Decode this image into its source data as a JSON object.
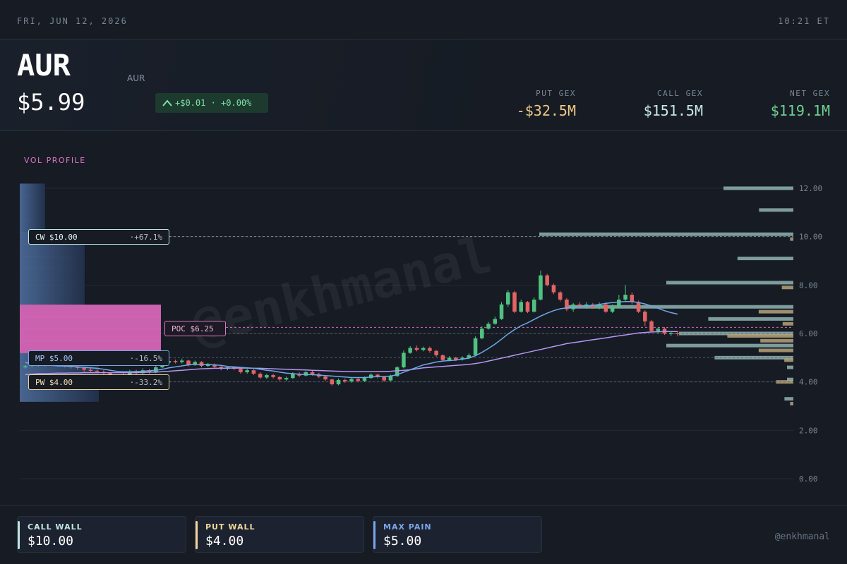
{
  "topbar": {
    "date": "FRI, JUN 12, 2026",
    "time": "10:21 ET"
  },
  "header": {
    "ticker": "AUR",
    "subname": "AUR",
    "price": "$5.99",
    "change": "+$0.01 · +0.00%",
    "put_gex": {
      "label": "PUT GEX",
      "value": "-$32.5M"
    },
    "call_gex": {
      "label": "CALL GEX",
      "value": "$151.5M"
    },
    "net_gex": {
      "label": "NET GEX",
      "value": "$119.1M"
    }
  },
  "chart": {
    "vol_profile_label": "VOL PROFILE",
    "watermark": "@enkhmanal",
    "tags": {
      "cw": {
        "label": "CW $10.00",
        "pct": "·+67.1%"
      },
      "mp": {
        "label": "MP $5.00",
        "pct": "·-16.5%"
      },
      "pw": {
        "label": "PW $4.00",
        "pct": "·-33.2%"
      },
      "poc": {
        "label": "POC $6.25"
      }
    }
  },
  "chart_data": {
    "type": "candlestick",
    "y_ticks": [
      "12.00",
      "10.00",
      "8.00",
      "6.00",
      "4.00",
      "2.00",
      "0.00"
    ],
    "ylim": [
      0,
      12
    ],
    "levels": {
      "call_wall": 10.0,
      "max_pain": 5.0,
      "put_wall": 4.0,
      "poc": 6.25,
      "last": 5.99
    },
    "candles": [
      [
        4.6,
        4.65,
        4.55,
        4.7
      ],
      [
        4.66,
        4.72,
        4.6,
        4.78
      ],
      [
        4.72,
        4.68,
        4.62,
        4.8
      ],
      [
        4.68,
        4.74,
        4.64,
        4.8
      ],
      [
        4.74,
        4.7,
        4.66,
        4.82
      ],
      [
        4.7,
        4.72,
        4.64,
        4.78
      ],
      [
        4.72,
        4.66,
        4.6,
        4.78
      ],
      [
        4.66,
        4.62,
        4.55,
        4.7
      ],
      [
        4.62,
        4.58,
        4.5,
        4.66
      ],
      [
        4.58,
        4.5,
        4.42,
        4.62
      ],
      [
        4.5,
        4.46,
        4.38,
        4.56
      ],
      [
        4.46,
        4.42,
        4.36,
        4.52
      ],
      [
        4.42,
        4.36,
        4.28,
        4.48
      ],
      [
        4.36,
        4.2,
        4.1,
        4.4
      ],
      [
        4.2,
        3.92,
        3.84,
        4.24
      ],
      [
        3.92,
        4.3,
        3.9,
        4.36
      ],
      [
        4.3,
        4.42,
        4.24,
        4.5
      ],
      [
        4.42,
        4.36,
        4.3,
        4.5
      ],
      [
        4.36,
        4.48,
        4.3,
        4.56
      ],
      [
        4.48,
        4.4,
        4.34,
        4.54
      ],
      [
        4.4,
        4.6,
        4.36,
        4.66
      ],
      [
        4.6,
        4.8,
        4.56,
        4.9
      ],
      [
        4.8,
        4.86,
        4.74,
        4.94
      ],
      [
        4.86,
        4.82,
        4.76,
        4.92
      ],
      [
        4.82,
        4.88,
        4.76,
        4.96
      ],
      [
        4.88,
        4.7,
        4.64,
        4.92
      ],
      [
        4.7,
        4.82,
        4.66,
        4.88
      ],
      [
        4.82,
        4.66,
        4.6,
        4.86
      ],
      [
        4.66,
        4.72,
        4.6,
        4.78
      ],
      [
        4.72,
        4.62,
        4.56,
        4.76
      ],
      [
        4.62,
        4.54,
        4.48,
        4.66
      ],
      [
        4.54,
        4.6,
        4.48,
        4.66
      ],
      [
        4.6,
        4.54,
        4.48,
        4.64
      ],
      [
        4.54,
        4.4,
        4.34,
        4.58
      ],
      [
        4.4,
        4.48,
        4.34,
        4.54
      ],
      [
        4.48,
        4.34,
        4.28,
        4.52
      ],
      [
        4.34,
        4.18,
        4.12,
        4.4
      ],
      [
        4.18,
        4.28,
        4.12,
        4.34
      ],
      [
        4.28,
        4.2,
        4.14,
        4.34
      ],
      [
        4.2,
        4.1,
        4.04,
        4.24
      ],
      [
        4.1,
        4.16,
        4.04,
        4.22
      ],
      [
        4.16,
        4.34,
        4.12,
        4.4
      ],
      [
        4.34,
        4.26,
        4.2,
        4.4
      ],
      [
        4.26,
        4.4,
        4.22,
        4.46
      ],
      [
        4.4,
        4.32,
        4.26,
        4.46
      ],
      [
        4.32,
        4.22,
        4.16,
        4.38
      ],
      [
        4.22,
        4.1,
        4.04,
        4.26
      ],
      [
        4.1,
        3.9,
        3.84,
        4.14
      ],
      [
        3.9,
        4.08,
        3.86,
        4.14
      ],
      [
        4.08,
        4.02,
        3.96,
        4.14
      ],
      [
        4.02,
        4.12,
        3.96,
        4.18
      ],
      [
        4.12,
        4.04,
        3.98,
        4.18
      ],
      [
        4.04,
        4.16,
        4.0,
        4.22
      ],
      [
        4.16,
        4.3,
        4.12,
        4.36
      ],
      [
        4.3,
        4.2,
        4.14,
        4.34
      ],
      [
        4.2,
        4.06,
        4.0,
        4.24
      ],
      [
        4.06,
        4.24,
        4.02,
        4.3
      ],
      [
        4.24,
        4.6,
        4.2,
        4.66
      ],
      [
        4.6,
        5.2,
        4.56,
        5.3
      ],
      [
        5.2,
        5.4,
        5.16,
        5.48
      ],
      [
        5.4,
        5.32,
        5.26,
        5.5
      ],
      [
        5.32,
        5.4,
        5.26,
        5.46
      ],
      [
        5.4,
        5.28,
        5.2,
        5.46
      ],
      [
        5.28,
        5.1,
        5.04,
        5.32
      ],
      [
        5.1,
        4.9,
        4.84,
        5.14
      ],
      [
        4.9,
        5.0,
        4.86,
        5.06
      ],
      [
        5.0,
        4.92,
        4.86,
        5.04
      ],
      [
        4.92,
        5.0,
        4.88,
        5.06
      ],
      [
        5.0,
        5.1,
        4.94,
        5.18
      ],
      [
        5.1,
        5.8,
        5.06,
        5.88
      ],
      [
        5.8,
        6.2,
        5.76,
        6.3
      ],
      [
        6.2,
        6.4,
        6.16,
        6.48
      ],
      [
        6.4,
        6.6,
        6.36,
        6.7
      ],
      [
        6.6,
        7.2,
        6.56,
        7.3
      ],
      [
        7.2,
        7.7,
        7.1,
        7.8
      ],
      [
        7.7,
        6.9,
        6.84,
        7.76
      ],
      [
        6.9,
        7.3,
        6.86,
        7.4
      ],
      [
        7.3,
        6.9,
        6.84,
        7.34
      ],
      [
        6.9,
        7.4,
        6.86,
        7.5
      ],
      [
        7.4,
        8.4,
        7.36,
        8.6
      ],
      [
        8.4,
        8.0,
        7.94,
        8.46
      ],
      [
        8.0,
        7.7,
        7.62,
        8.06
      ],
      [
        7.7,
        7.4,
        7.32,
        7.76
      ],
      [
        7.4,
        7.0,
        6.92,
        7.46
      ],
      [
        7.0,
        7.2,
        6.9,
        7.26
      ],
      [
        7.2,
        7.1,
        7.02,
        7.3
      ],
      [
        7.1,
        7.2,
        7.02,
        7.3
      ],
      [
        7.2,
        7.1,
        7.02,
        7.26
      ],
      [
        7.1,
        7.2,
        7.0,
        7.28
      ],
      [
        7.2,
        6.9,
        6.84,
        7.3
      ],
      [
        6.9,
        7.1,
        6.84,
        7.2
      ],
      [
        7.1,
        7.4,
        7.04,
        7.6
      ],
      [
        7.4,
        7.6,
        7.3,
        8.0
      ],
      [
        7.6,
        7.3,
        7.2,
        7.7
      ],
      [
        7.3,
        6.9,
        6.84,
        7.36
      ],
      [
        6.9,
        6.5,
        6.3,
        6.96
      ],
      [
        6.5,
        6.1,
        6.04,
        6.56
      ],
      [
        6.1,
        6.2,
        6.0,
        6.26
      ],
      [
        6.2,
        6.0,
        5.94,
        6.26
      ],
      [
        6.0,
        6.02,
        5.9,
        6.1
      ],
      [
        6.02,
        5.99,
        5.88,
        6.1
      ]
    ],
    "ma_fast": [
      4.8,
      4.76,
      4.72,
      4.7,
      4.68,
      4.66,
      4.65,
      4.64,
      4.62,
      4.6,
      4.58,
      4.56,
      4.52,
      4.48,
      4.44,
      4.42,
      4.42,
      4.43,
      4.44,
      4.46,
      4.48,
      4.52,
      4.58,
      4.62,
      4.66,
      4.7,
      4.72,
      4.72,
      4.72,
      4.7,
      4.68,
      4.64,
      4.62,
      4.6,
      4.58,
      4.56,
      4.52,
      4.48,
      4.45,
      4.4,
      4.36,
      4.34,
      4.32,
      4.3,
      4.3,
      4.28,
      4.26,
      4.24,
      4.22,
      4.2,
      4.18,
      4.18,
      4.18,
      4.2,
      4.22,
      4.22,
      4.24,
      4.3,
      4.4,
      4.5,
      4.6,
      4.7,
      4.76,
      4.82,
      4.86,
      4.88,
      4.9,
      4.94,
      4.98,
      5.08,
      5.22,
      5.38,
      5.56,
      5.76,
      5.98,
      6.16,
      6.32,
      6.44,
      6.58,
      6.72,
      6.84,
      6.94,
      7.02,
      7.06,
      7.1,
      7.12,
      7.14,
      7.16,
      7.2,
      7.24,
      7.28,
      7.3,
      7.32,
      7.32,
      7.28,
      7.22,
      7.14,
      7.04,
      6.94,
      6.86,
      6.8
    ],
    "ma_slow": [
      4.3,
      4.32,
      4.34,
      4.34,
      4.35,
      4.36,
      4.36,
      4.37,
      4.37,
      4.38,
      4.38,
      4.38,
      4.38,
      4.38,
      4.38,
      4.38,
      4.38,
      4.38,
      4.39,
      4.4,
      4.4,
      4.42,
      4.44,
      4.46,
      4.48,
      4.5,
      4.52,
      4.54,
      4.55,
      4.56,
      4.56,
      4.57,
      4.57,
      4.57,
      4.57,
      4.56,
      4.56,
      4.55,
      4.54,
      4.53,
      4.52,
      4.51,
      4.5,
      4.49,
      4.48,
      4.47,
      4.46,
      4.45,
      4.44,
      4.43,
      4.42,
      4.42,
      4.42,
      4.42,
      4.42,
      4.43,
      4.44,
      4.46,
      4.48,
      4.5,
      4.54,
      4.58,
      4.6,
      4.62,
      4.64,
      4.66,
      4.68,
      4.7,
      4.72,
      4.76,
      4.8,
      4.86,
      4.92,
      4.98,
      5.04,
      5.1,
      5.16,
      5.22,
      5.28,
      5.34,
      5.4,
      5.46,
      5.52,
      5.58,
      5.62,
      5.66,
      5.7,
      5.74,
      5.78,
      5.82,
      5.86,
      5.9,
      5.94,
      5.98,
      6.02,
      6.04,
      6.06,
      6.07,
      6.08,
      6.08,
      6.08
    ],
    "left_profile": [
      {
        "price": 12.0,
        "size": 0.18
      },
      {
        "price": 11.5,
        "size": 0.18
      },
      {
        "price": 11.0,
        "size": 0.18
      },
      {
        "price": 10.5,
        "size": 0.18
      },
      {
        "price": 10.0,
        "size": 0.46
      },
      {
        "price": 9.5,
        "size": 0.46
      },
      {
        "price": 9.0,
        "size": 0.46
      },
      {
        "price": 8.5,
        "size": 0.46
      },
      {
        "price": 8.0,
        "size": 0.46
      },
      {
        "price": 7.5,
        "size": 0.46
      },
      {
        "price": 7.0,
        "size": 1.0
      },
      {
        "price": 6.5,
        "size": 1.0
      },
      {
        "price": 6.0,
        "size": 1.0
      },
      {
        "price": 5.5,
        "size": 1.0
      },
      {
        "price": 5.0,
        "size": 0.46
      },
      {
        "price": 4.5,
        "size": 0.56
      },
      {
        "price": 4.0,
        "size": 0.56
      },
      {
        "price": 3.5,
        "size": 0.56
      }
    ],
    "right_bars_call": [
      {
        "price": 12.0,
        "size": 0.55
      },
      {
        "price": 11.1,
        "size": 0.27
      },
      {
        "price": 10.1,
        "size": 2.0
      },
      {
        "price": 9.1,
        "size": 0.44
      },
      {
        "price": 8.1,
        "size": 1.0
      },
      {
        "price": 7.1,
        "size": 1.78
      },
      {
        "price": 6.6,
        "size": 0.67
      },
      {
        "price": 6.0,
        "size": 0.9
      },
      {
        "price": 5.5,
        "size": 1.0
      },
      {
        "price": 5.0,
        "size": 0.62
      },
      {
        "price": 4.6,
        "size": 0.05
      },
      {
        "price": 4.1,
        "size": 0.05
      },
      {
        "price": 3.3,
        "size": 0.07
      }
    ],
    "right_bars_put": [
      {
        "price": 9.9,
        "size": 0.04
      },
      {
        "price": 7.9,
        "size": 0.14
      },
      {
        "price": 6.9,
        "size": 0.42
      },
      {
        "price": 6.4,
        "size": 0.13
      },
      {
        "price": 5.9,
        "size": 0.8
      },
      {
        "price": 5.7,
        "size": 0.4
      },
      {
        "price": 5.3,
        "size": 0.42
      },
      {
        "price": 4.9,
        "size": 0.11
      },
      {
        "price": 4.0,
        "size": 0.21
      },
      {
        "price": 3.1,
        "size": 0.04
      }
    ]
  },
  "footer": {
    "call_wall": {
      "label": "CALL WALL",
      "value": "$10.00"
    },
    "put_wall": {
      "label": "PUT WALL",
      "value": "$4.00"
    },
    "max_pain": {
      "label": "MAX PAIN",
      "value": "$5.00"
    },
    "handle": "@enkhmanal"
  },
  "colors": {
    "up": "#4fc27f",
    "down": "#e26464",
    "ma_fast": "#6ea8e8",
    "ma_slow": "#b497f0",
    "poc": "#d566b8",
    "call_bar": "#8fb3b0",
    "put_bar": "#b5a27a"
  }
}
